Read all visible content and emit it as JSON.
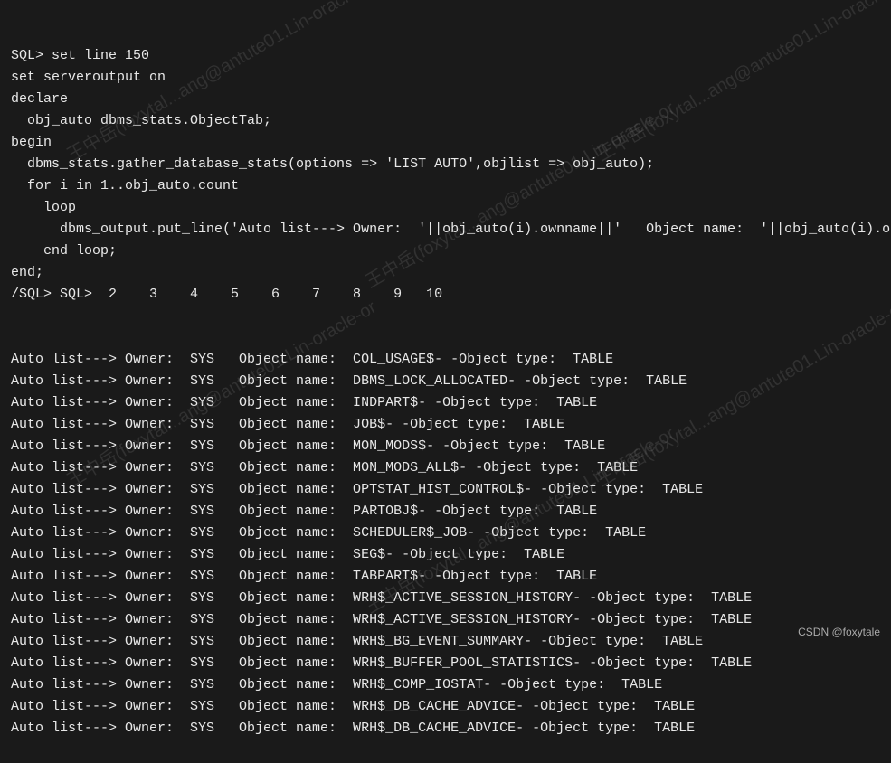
{
  "code_lines": [
    "SQL> set line 150",
    "set serveroutput on",
    "declare",
    "  obj_auto dbms_stats.ObjectTab;",
    "begin",
    "  dbms_stats.gather_database_stats(options => 'LIST AUTO',objlist => obj_auto);",
    "  for i in 1..obj_auto.count",
    "    loop",
    "      dbms_output.put_line('Auto list---> Owner:  '||obj_auto(i).ownname||'   Object name:  '||obj_auto(i).o",
    "    end loop;",
    "end;",
    "/SQL> SQL>  2    3    4    5    6    7    8    9   10"
  ],
  "output_rows": [
    {
      "owner": "SYS",
      "object_name": "COL_USAGE$-",
      "object_type": "TABLE"
    },
    {
      "owner": "SYS",
      "object_name": "DBMS_LOCK_ALLOCATED-",
      "object_type": "TABLE"
    },
    {
      "owner": "SYS",
      "object_name": "INDPART$-",
      "object_type": "TABLE"
    },
    {
      "owner": "SYS",
      "object_name": "JOB$-",
      "object_type": "TABLE"
    },
    {
      "owner": "SYS",
      "object_name": "MON_MODS$-",
      "object_type": "TABLE"
    },
    {
      "owner": "SYS",
      "object_name": "MON_MODS_ALL$-",
      "object_type": "TABLE"
    },
    {
      "owner": "SYS",
      "object_name": "OPTSTAT_HIST_CONTROL$-",
      "object_type": "TABLE"
    },
    {
      "owner": "SYS",
      "object_name": "PARTOBJ$-",
      "object_type": "TABLE"
    },
    {
      "owner": "SYS",
      "object_name": "SCHEDULER$_JOB-",
      "object_type": "TABLE"
    },
    {
      "owner": "SYS",
      "object_name": "SEG$-",
      "object_type": "TABLE"
    },
    {
      "owner": "SYS",
      "object_name": "TABPART$-",
      "object_type": "TABLE"
    },
    {
      "owner": "SYS",
      "object_name": "WRH$_ACTIVE_SESSION_HISTORY-",
      "object_type": "TABLE"
    },
    {
      "owner": "SYS",
      "object_name": "WRH$_ACTIVE_SESSION_HISTORY-",
      "object_type": "TABLE"
    },
    {
      "owner": "SYS",
      "object_name": "WRH$_BG_EVENT_SUMMARY-",
      "object_type": "TABLE"
    },
    {
      "owner": "SYS",
      "object_name": "WRH$_BUFFER_POOL_STATISTICS-",
      "object_type": "TABLE"
    },
    {
      "owner": "SYS",
      "object_name": "WRH$_COMP_IOSTAT-",
      "object_type": "TABLE"
    },
    {
      "owner": "SYS",
      "object_name": "WRH$_DB_CACHE_ADVICE-",
      "object_type": "TABLE"
    },
    {
      "owner": "SYS",
      "object_name": "WRH$_DB_CACHE_ADVICE-",
      "object_type": "TABLE"
    }
  ],
  "prefix": "Auto list---> Owner:  ",
  "obj_label": "   Object name:  ",
  "type_label": " -Object type:  ",
  "watermark_text": "王中岳(foxytal...ang@antute01.Lin-oracle-or",
  "attribution": "CSDN @foxytale"
}
